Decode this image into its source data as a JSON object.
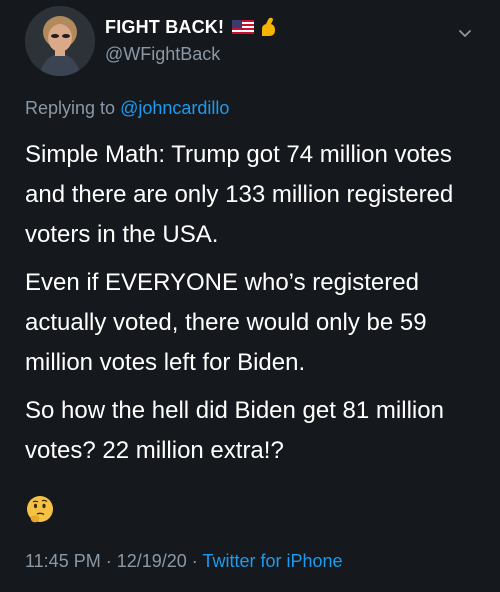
{
  "author": {
    "name": "FIGHT BACK!",
    "handle": "@WFightBack",
    "badge_icons": [
      "us-flag-icon",
      "flexed-biceps-icon"
    ]
  },
  "reply": {
    "prefix": "Replying to ",
    "to_handle": "@johncardillo"
  },
  "body": {
    "paragraph_1": "Simple Math: Trump got 74 million votes and there are only 133 million registered voters in the USA.",
    "paragraph_2": "Even if EVERYONE who’s registered actually voted, there would only be 59 million votes left for Biden.",
    "paragraph_3": "So how the hell did Biden get 81 million votes? 22 million extra!?",
    "emoji": "thinking-face-icon"
  },
  "meta": {
    "time": "11:45 PM",
    "sep1": " · ",
    "date": "12/19/20",
    "sep2": " · ",
    "source": "Twitter for iPhone"
  },
  "colors": {
    "background": "#15181c",
    "text": "#ffffff",
    "secondary": "#8b98a5",
    "link": "#1d9bf0"
  }
}
